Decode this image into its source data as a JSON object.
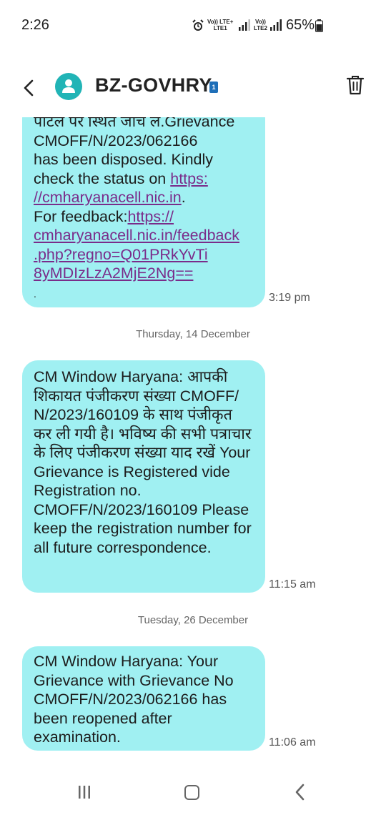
{
  "status_bar": {
    "time": "2:26",
    "net1_top": "Vo)) LTE+",
    "net1_bottom": "LTE1",
    "net2_top": "Vo))",
    "net2_bottom": "LTE2",
    "battery_percent": "65%"
  },
  "header": {
    "back_icon": "chevron-left-icon",
    "avatar_icon": "person-icon",
    "title": "BZ-GOVHRY",
    "sim_badge": "1",
    "delete_icon": "trash-icon"
  },
  "messages": [
    {
      "lines": [
        "पटिल पर स्थित जांच ले.Grievance",
        "CMOFF/N/2023/062166",
        "has been disposed. Kindly",
        "check the status on "
      ],
      "link1_a": "https:",
      "link1_b": "//cmharyanacell.nic.in",
      "after_link1": ".",
      "feedback_label": "For feedback:",
      "link2_a": "https://",
      "link2_b": "cmharyanacell.nic.in/feedback",
      "link2_c": ".php?regno=Q01PRkYvTi",
      "link2_d": "8yMDIzLzA2MjE2Ng==",
      "tail": ".",
      "time": "3:19 pm"
    },
    {
      "date_separator": "Thursday, 14 December",
      "text": "CM Window Haryana: आपकी शिकायत पंजीकरण संख्या  CMOFF/ N/2023/160109 के साथ  पंजीकृत कर ली गयी है। भविष्य की सभी पत्राचार के लिए पंजीकरण संख्या याद रखें  Your Grievance is Registered vide Registration no. CMOFF/N/2023/160109 Please keep the registration number for all future correspondence.",
      "time": "11:15 am"
    },
    {
      "date_separator": "Tuesday, 26 December",
      "text": "CM Window Haryana: Your Grievance with Grievance No CMOFF/N/2023/062166 has been reopened after examination.",
      "time": "11:06 am"
    }
  ],
  "nav_bar": {
    "recent_icon": "recent-apps-icon",
    "home_icon": "home-icon",
    "back_icon": "back-icon"
  }
}
